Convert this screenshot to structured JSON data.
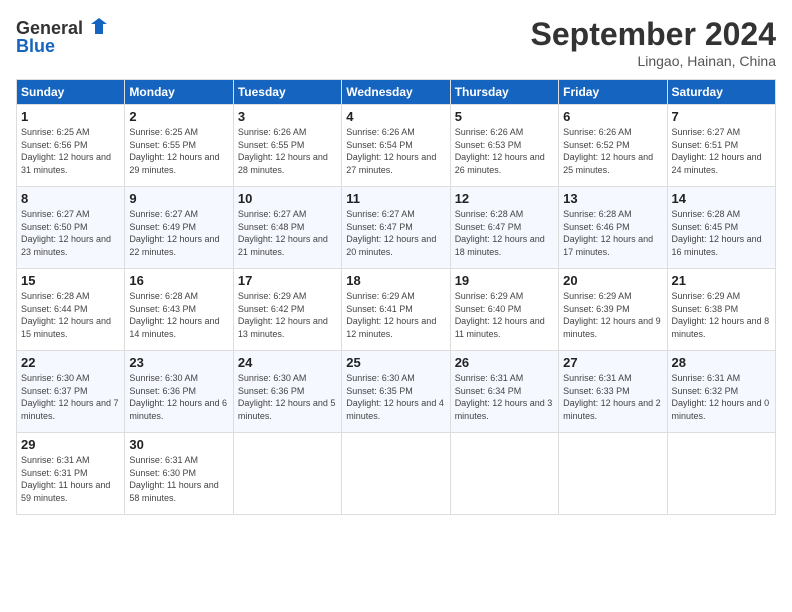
{
  "header": {
    "logo": {
      "general": "General",
      "blue": "Blue"
    },
    "title": "September 2024",
    "subtitle": "Lingao, Hainan, China"
  },
  "days_of_week": [
    "Sunday",
    "Monday",
    "Tuesday",
    "Wednesday",
    "Thursday",
    "Friday",
    "Saturday"
  ],
  "weeks": [
    [
      {
        "day": "1",
        "info": "Sunrise: 6:25 AM\nSunset: 6:56 PM\nDaylight: 12 hours and 31 minutes."
      },
      {
        "day": "2",
        "info": "Sunrise: 6:25 AM\nSunset: 6:55 PM\nDaylight: 12 hours and 29 minutes."
      },
      {
        "day": "3",
        "info": "Sunrise: 6:26 AM\nSunset: 6:55 PM\nDaylight: 12 hours and 28 minutes."
      },
      {
        "day": "4",
        "info": "Sunrise: 6:26 AM\nSunset: 6:54 PM\nDaylight: 12 hours and 27 minutes."
      },
      {
        "day": "5",
        "info": "Sunrise: 6:26 AM\nSunset: 6:53 PM\nDaylight: 12 hours and 26 minutes."
      },
      {
        "day": "6",
        "info": "Sunrise: 6:26 AM\nSunset: 6:52 PM\nDaylight: 12 hours and 25 minutes."
      },
      {
        "day": "7",
        "info": "Sunrise: 6:27 AM\nSunset: 6:51 PM\nDaylight: 12 hours and 24 minutes."
      }
    ],
    [
      {
        "day": "8",
        "info": "Sunrise: 6:27 AM\nSunset: 6:50 PM\nDaylight: 12 hours and 23 minutes."
      },
      {
        "day": "9",
        "info": "Sunrise: 6:27 AM\nSunset: 6:49 PM\nDaylight: 12 hours and 22 minutes."
      },
      {
        "day": "10",
        "info": "Sunrise: 6:27 AM\nSunset: 6:48 PM\nDaylight: 12 hours and 21 minutes."
      },
      {
        "day": "11",
        "info": "Sunrise: 6:27 AM\nSunset: 6:47 PM\nDaylight: 12 hours and 20 minutes."
      },
      {
        "day": "12",
        "info": "Sunrise: 6:28 AM\nSunset: 6:47 PM\nDaylight: 12 hours and 18 minutes."
      },
      {
        "day": "13",
        "info": "Sunrise: 6:28 AM\nSunset: 6:46 PM\nDaylight: 12 hours and 17 minutes."
      },
      {
        "day": "14",
        "info": "Sunrise: 6:28 AM\nSunset: 6:45 PM\nDaylight: 12 hours and 16 minutes."
      }
    ],
    [
      {
        "day": "15",
        "info": "Sunrise: 6:28 AM\nSunset: 6:44 PM\nDaylight: 12 hours and 15 minutes."
      },
      {
        "day": "16",
        "info": "Sunrise: 6:28 AM\nSunset: 6:43 PM\nDaylight: 12 hours and 14 minutes."
      },
      {
        "day": "17",
        "info": "Sunrise: 6:29 AM\nSunset: 6:42 PM\nDaylight: 12 hours and 13 minutes."
      },
      {
        "day": "18",
        "info": "Sunrise: 6:29 AM\nSunset: 6:41 PM\nDaylight: 12 hours and 12 minutes."
      },
      {
        "day": "19",
        "info": "Sunrise: 6:29 AM\nSunset: 6:40 PM\nDaylight: 12 hours and 11 minutes."
      },
      {
        "day": "20",
        "info": "Sunrise: 6:29 AM\nSunset: 6:39 PM\nDaylight: 12 hours and 9 minutes."
      },
      {
        "day": "21",
        "info": "Sunrise: 6:29 AM\nSunset: 6:38 PM\nDaylight: 12 hours and 8 minutes."
      }
    ],
    [
      {
        "day": "22",
        "info": "Sunrise: 6:30 AM\nSunset: 6:37 PM\nDaylight: 12 hours and 7 minutes."
      },
      {
        "day": "23",
        "info": "Sunrise: 6:30 AM\nSunset: 6:36 PM\nDaylight: 12 hours and 6 minutes."
      },
      {
        "day": "24",
        "info": "Sunrise: 6:30 AM\nSunset: 6:36 PM\nDaylight: 12 hours and 5 minutes."
      },
      {
        "day": "25",
        "info": "Sunrise: 6:30 AM\nSunset: 6:35 PM\nDaylight: 12 hours and 4 minutes."
      },
      {
        "day": "26",
        "info": "Sunrise: 6:31 AM\nSunset: 6:34 PM\nDaylight: 12 hours and 3 minutes."
      },
      {
        "day": "27",
        "info": "Sunrise: 6:31 AM\nSunset: 6:33 PM\nDaylight: 12 hours and 2 minutes."
      },
      {
        "day": "28",
        "info": "Sunrise: 6:31 AM\nSunset: 6:32 PM\nDaylight: 12 hours and 0 minutes."
      }
    ],
    [
      {
        "day": "29",
        "info": "Sunrise: 6:31 AM\nSunset: 6:31 PM\nDaylight: 11 hours and 59 minutes."
      },
      {
        "day": "30",
        "info": "Sunrise: 6:31 AM\nSunset: 6:30 PM\nDaylight: 11 hours and 58 minutes."
      },
      {
        "day": "",
        "info": ""
      },
      {
        "day": "",
        "info": ""
      },
      {
        "day": "",
        "info": ""
      },
      {
        "day": "",
        "info": ""
      },
      {
        "day": "",
        "info": ""
      }
    ]
  ]
}
